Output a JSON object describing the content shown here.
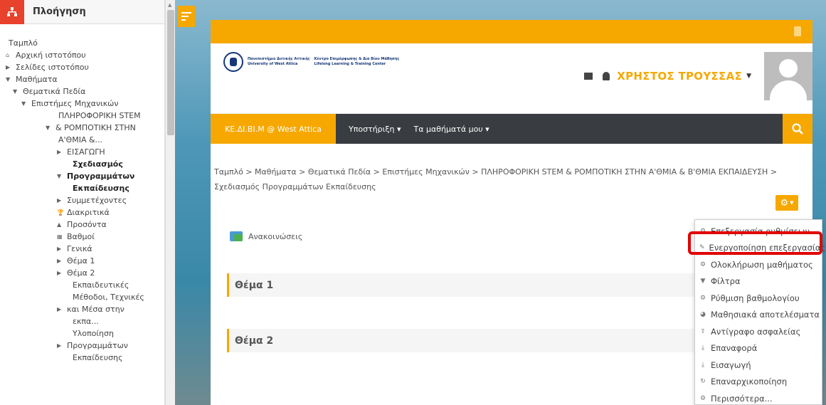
{
  "sidebar": {
    "title": "Πλοήγηση",
    "items": [
      {
        "label": "Ταμπλό",
        "indent": 0,
        "toggle": "",
        "bold": false
      },
      {
        "label": "Αρχική ιστοτόπου",
        "indent": 0,
        "toggle": "home",
        "bold": false
      },
      {
        "label": "Σελίδες ιστοτόπου",
        "indent": 0,
        "toggle": "right",
        "bold": false
      },
      {
        "label": "Μαθήματα",
        "indent": 0,
        "toggle": "down",
        "bold": false
      },
      {
        "label": "Θεματικά Πεδία",
        "indent": 1,
        "toggle": "down",
        "bold": false
      },
      {
        "label": "Επιστήμες Μηχανικών",
        "indent": 2,
        "toggle": "down",
        "bold": false
      },
      {
        "label": "ΠΛΗΡΟΦΟΡΙΚΗ STEM",
        "indent": 3,
        "toggle": "",
        "bold": false
      },
      {
        "label": "& ΡΟΜΠΟΤΙΚΗ ΣΤΗΝ",
        "indent": 3,
        "toggle": "down",
        "bold": false
      },
      {
        "label": "Α'ΘΜΙΑ &...",
        "indent": 3,
        "toggle": "",
        "bold": false
      },
      {
        "label": "ΕΙΣΑΓΩΓΗ",
        "indent": 4,
        "toggle": "right",
        "bold": false
      },
      {
        "label": "Σχεδιασμός",
        "indent": 4,
        "toggle": "",
        "bold": true
      },
      {
        "label": "Προγραμμάτων",
        "indent": 4,
        "toggle": "down",
        "bold": true
      },
      {
        "label": "Εκπαίδευσης",
        "indent": 4,
        "toggle": "",
        "bold": true
      },
      {
        "label": "Συμμετέχοντες",
        "indent": 5,
        "toggle": "right",
        "bold": false
      },
      {
        "label": "Διακριτικά",
        "indent": 5,
        "toggle": "trophy",
        "bold": false
      },
      {
        "label": "Προσόντα",
        "indent": 5,
        "toggle": "award",
        "bold": false
      },
      {
        "label": "Βαθμοί",
        "indent": 5,
        "toggle": "table",
        "bold": false
      },
      {
        "label": "Γενικά",
        "indent": 5,
        "toggle": "right",
        "bold": false
      },
      {
        "label": "Θέμα 1",
        "indent": 5,
        "toggle": "right",
        "bold": false
      },
      {
        "label": "Θέμα 2",
        "indent": 5,
        "toggle": "right",
        "bold": false
      },
      {
        "label": "Εκπαιδευτικές",
        "indent": 5,
        "toggle": "",
        "bold": false
      },
      {
        "label": "Μέθοδοι, Τεχνικές",
        "indent": 5,
        "toggle": "",
        "bold": false
      },
      {
        "label": "και Μέσα στην",
        "indent": 5,
        "toggle": "right",
        "bold": false
      },
      {
        "label": "εκπα...",
        "indent": 5,
        "toggle": "",
        "bold": false
      },
      {
        "label": "Υλοποίηση",
        "indent": 5,
        "toggle": "",
        "bold": false
      },
      {
        "label": "Προγραμμάτων",
        "indent": 5,
        "toggle": "right",
        "bold": false
      },
      {
        "label": "Εκπαίδευσης",
        "indent": 5,
        "toggle": "",
        "bold": false
      }
    ]
  },
  "logo": {
    "line1": "Πανεπιστήμιο Δυτικής Αττικής",
    "line2": "University of West Attica",
    "line3": "Κέντρο Επιμόρφωσης & Δια Βίου Μάθησης",
    "line4": "Lifelong Learning & Training Center"
  },
  "header": {
    "username": "ΧΡΗΣΤΟΣ ΤΡΟΥΣΣΑΣ"
  },
  "navbar": {
    "brand": "ΚΕ.ΔΙ.ΒΙ.Μ @ West Attica",
    "support": "Υποστήριξη",
    "mycourses": "Τα μαθήματά μου"
  },
  "breadcrumb": "Ταμπλό > Μαθήματα > Θεματικά Πεδία > Επιστήμες Μηχανικών > ΠΛΗΡΟΦΟΡΙΚΗ STEM & ΡΟΜΠΟΤΙΚΗ ΣΤΗΝ Α'ΘΜΙΑ & Β'ΘΜΙΑ ΕΚΠΑΙΔΕΥΣΗ > Σχεδιασμός Προγραμμάτων Εκπαίδευσης",
  "announcements": "Ανακοινώσεις",
  "sections": [
    "Θέμα 1",
    "Θέμα 2"
  ],
  "menu": [
    {
      "label": "Επεξεργασία ρυθμίσεων",
      "icon": "gear-icon"
    },
    {
      "label": "Ενεργοποίηση επεξεργασίας",
      "icon": "pencil-icon"
    },
    {
      "label": "Ολοκλήρωση μαθήματος",
      "icon": "gear-icon"
    },
    {
      "label": "Φίλτρα",
      "icon": "filter-icon"
    },
    {
      "label": "Ρύθμιση βαθμολογίου",
      "icon": "gear-icon"
    },
    {
      "label": "Μαθησιακά αποτελέσματα",
      "icon": "pie-icon"
    },
    {
      "label": "Αντίγραφο ασφαλείας",
      "icon": "upload-icon"
    },
    {
      "label": "Επαναφορά",
      "icon": "download-icon"
    },
    {
      "label": "Εισαγωγή",
      "icon": "download-icon"
    },
    {
      "label": "Επαναρχικοποίηση",
      "icon": "refresh-icon"
    },
    {
      "label": "Περισσότερα...",
      "icon": "gear-icon"
    }
  ],
  "colors": {
    "accent": "#f6a800",
    "nav": "#393c40",
    "highlight": "#e10000"
  }
}
